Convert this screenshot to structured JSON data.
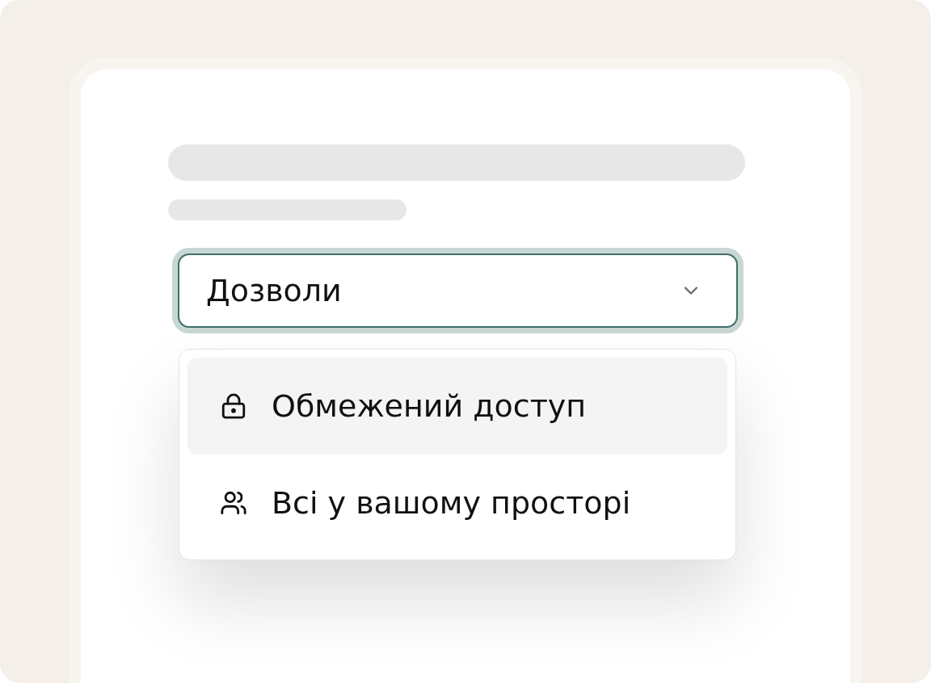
{
  "select": {
    "value": "Дозволи",
    "expanded": true
  },
  "menu": {
    "items": [
      {
        "kind": "lock",
        "label": "Обмежений доступ",
        "selected": true
      },
      {
        "kind": "people",
        "label": "Всі у вашому просторі",
        "selected": false
      }
    ]
  }
}
